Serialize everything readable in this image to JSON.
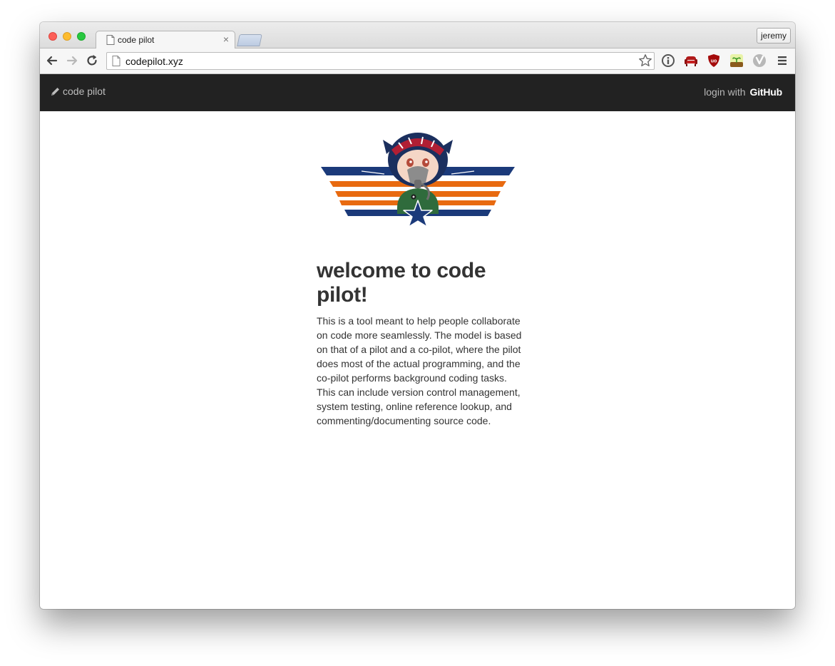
{
  "browser": {
    "tab_title": "code pilot",
    "tab_close": "×",
    "profile_name": "jeremy",
    "url": "codepilot.xyz"
  },
  "app": {
    "brand": "code pilot",
    "login_label": "login with",
    "github_label": "GitHub"
  },
  "main": {
    "heading": "welcome to code pilot!",
    "description": "This is a tool meant to help people collaborate on code more seamlessly. The model is based on that of a pilot and a co-pilot, where the pilot does most of the actual programming, and the co-pilot performs background coding tasks. This can include version control management, system testing, online reference lookup, and commenting/documenting source code."
  },
  "colors": {
    "navbar": "#222222",
    "wing_blue": "#1b3a7a",
    "wing_orange": "#e86a10"
  }
}
